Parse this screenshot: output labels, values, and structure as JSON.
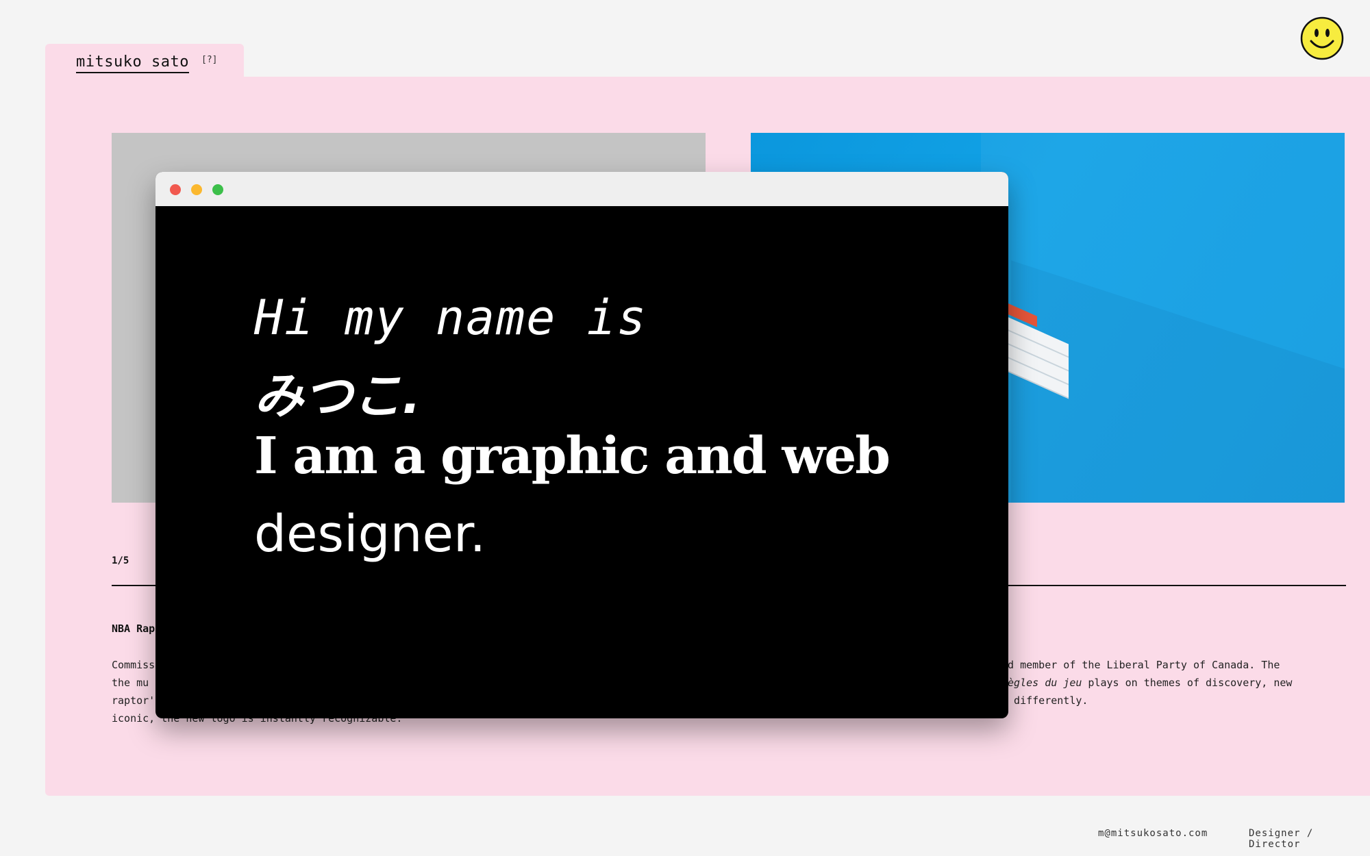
{
  "header": {
    "site_name": "mitsuko sato",
    "help_label": "[?]",
    "logo_icon": "smiley-face-icon"
  },
  "project": {
    "counter": "1/5",
    "title": "NBA Rap",
    "description_left_lines": [
      "Commiss",
      "the mu",
      "raptor'",
      "iconic, the new logo is instantly recognizable."
    ],
    "description_right_lines": [
      "nd member of the Liberal Party of Canada. The",
      "règles du jeu plays on themes of discovery, new",
      "s differently."
    ],
    "right_italic_fragment": "règles du jeu"
  },
  "hero_window": {
    "line1": "Hi my name is",
    "line2": "みつこ.",
    "line3": "I am a graphic and web",
    "line4": "designer."
  },
  "footer": {
    "email": "m@mitsukosato.com",
    "role": "Designer / Director"
  },
  "colors": {
    "page_bg": "#f4f4f4",
    "panel_bg": "#fbdbe8",
    "image_left": "#c4c4c4",
    "image_right": "#0f9ae0",
    "window_bg": "#000000",
    "smiley": "#f7ec3f"
  }
}
